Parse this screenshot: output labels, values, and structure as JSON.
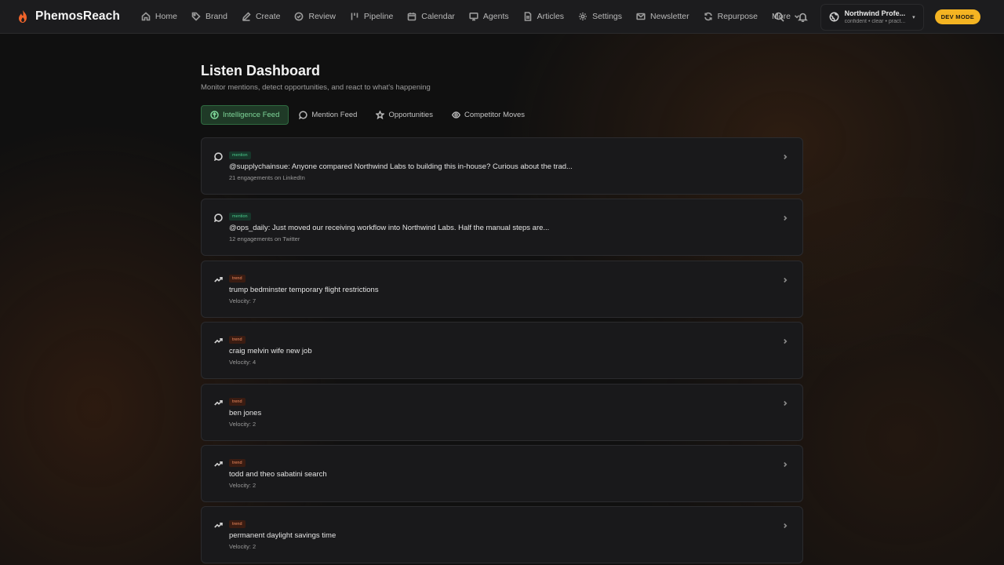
{
  "app": {
    "name": "PhemosReach",
    "brand_color": "#f0642a"
  },
  "nav": {
    "items": [
      {
        "label": "Home",
        "icon": "home-icon"
      },
      {
        "label": "Brand",
        "icon": "tag-icon"
      },
      {
        "label": "Create",
        "icon": "pen-icon"
      },
      {
        "label": "Review",
        "icon": "check-circle-icon"
      },
      {
        "label": "Pipeline",
        "icon": "pipeline-icon"
      },
      {
        "label": "Calendar",
        "icon": "calendar-icon"
      },
      {
        "label": "Agents",
        "icon": "monitor-icon"
      },
      {
        "label": "Articles",
        "icon": "file-icon"
      },
      {
        "label": "Settings",
        "icon": "gear-icon"
      },
      {
        "label": "Newsletter",
        "icon": "mail-icon"
      },
      {
        "label": "Repurpose",
        "icon": "refresh-icon"
      },
      {
        "label": "More",
        "icon": "chevron-down-icon"
      }
    ]
  },
  "profile": {
    "name": "Northwind Profe...",
    "subtitle": "confident • clear • pract..."
  },
  "dev_badge": "DEV MODE",
  "page": {
    "title": "Listen Dashboard",
    "subtitle": "Monitor mentions, detect opportunities, and react to what's happening"
  },
  "tabs": [
    {
      "label": "Intelligence Feed",
      "icon": "compass-icon",
      "active": true
    },
    {
      "label": "Mention Feed",
      "icon": "chat-bubble-icon",
      "active": false
    },
    {
      "label": "Opportunities",
      "icon": "star-icon",
      "active": false
    },
    {
      "label": "Competitor Moves",
      "icon": "eye-icon",
      "active": false
    }
  ],
  "feed": [
    {
      "type": "mention",
      "title": "@supplychainsue: Anyone compared Northwind Labs to building this in-house? Curious about the trad...",
      "meta": "21 engagements on LinkedIn"
    },
    {
      "type": "mention",
      "title": "@ops_daily: Just moved our receiving workflow into Northwind Labs. Half the manual steps are...",
      "meta": "12 engagements on Twitter"
    },
    {
      "type": "trend",
      "title": "trump bedminster temporary flight restrictions",
      "meta": "Velocity: 7"
    },
    {
      "type": "trend",
      "title": "craig melvin wife new job",
      "meta": "Velocity: 4"
    },
    {
      "type": "trend",
      "title": "ben jones",
      "meta": "Velocity: 2"
    },
    {
      "type": "trend",
      "title": "todd and theo sabatini search",
      "meta": "Velocity: 2"
    },
    {
      "type": "trend",
      "title": "permanent daylight savings time",
      "meta": "Velocity: 2"
    }
  ],
  "colors": {
    "mention_tag": "#49c98a",
    "trend_tag": "#f08a5d",
    "active_tab": "#7fd89a",
    "dev_badge": "#f4b422"
  }
}
